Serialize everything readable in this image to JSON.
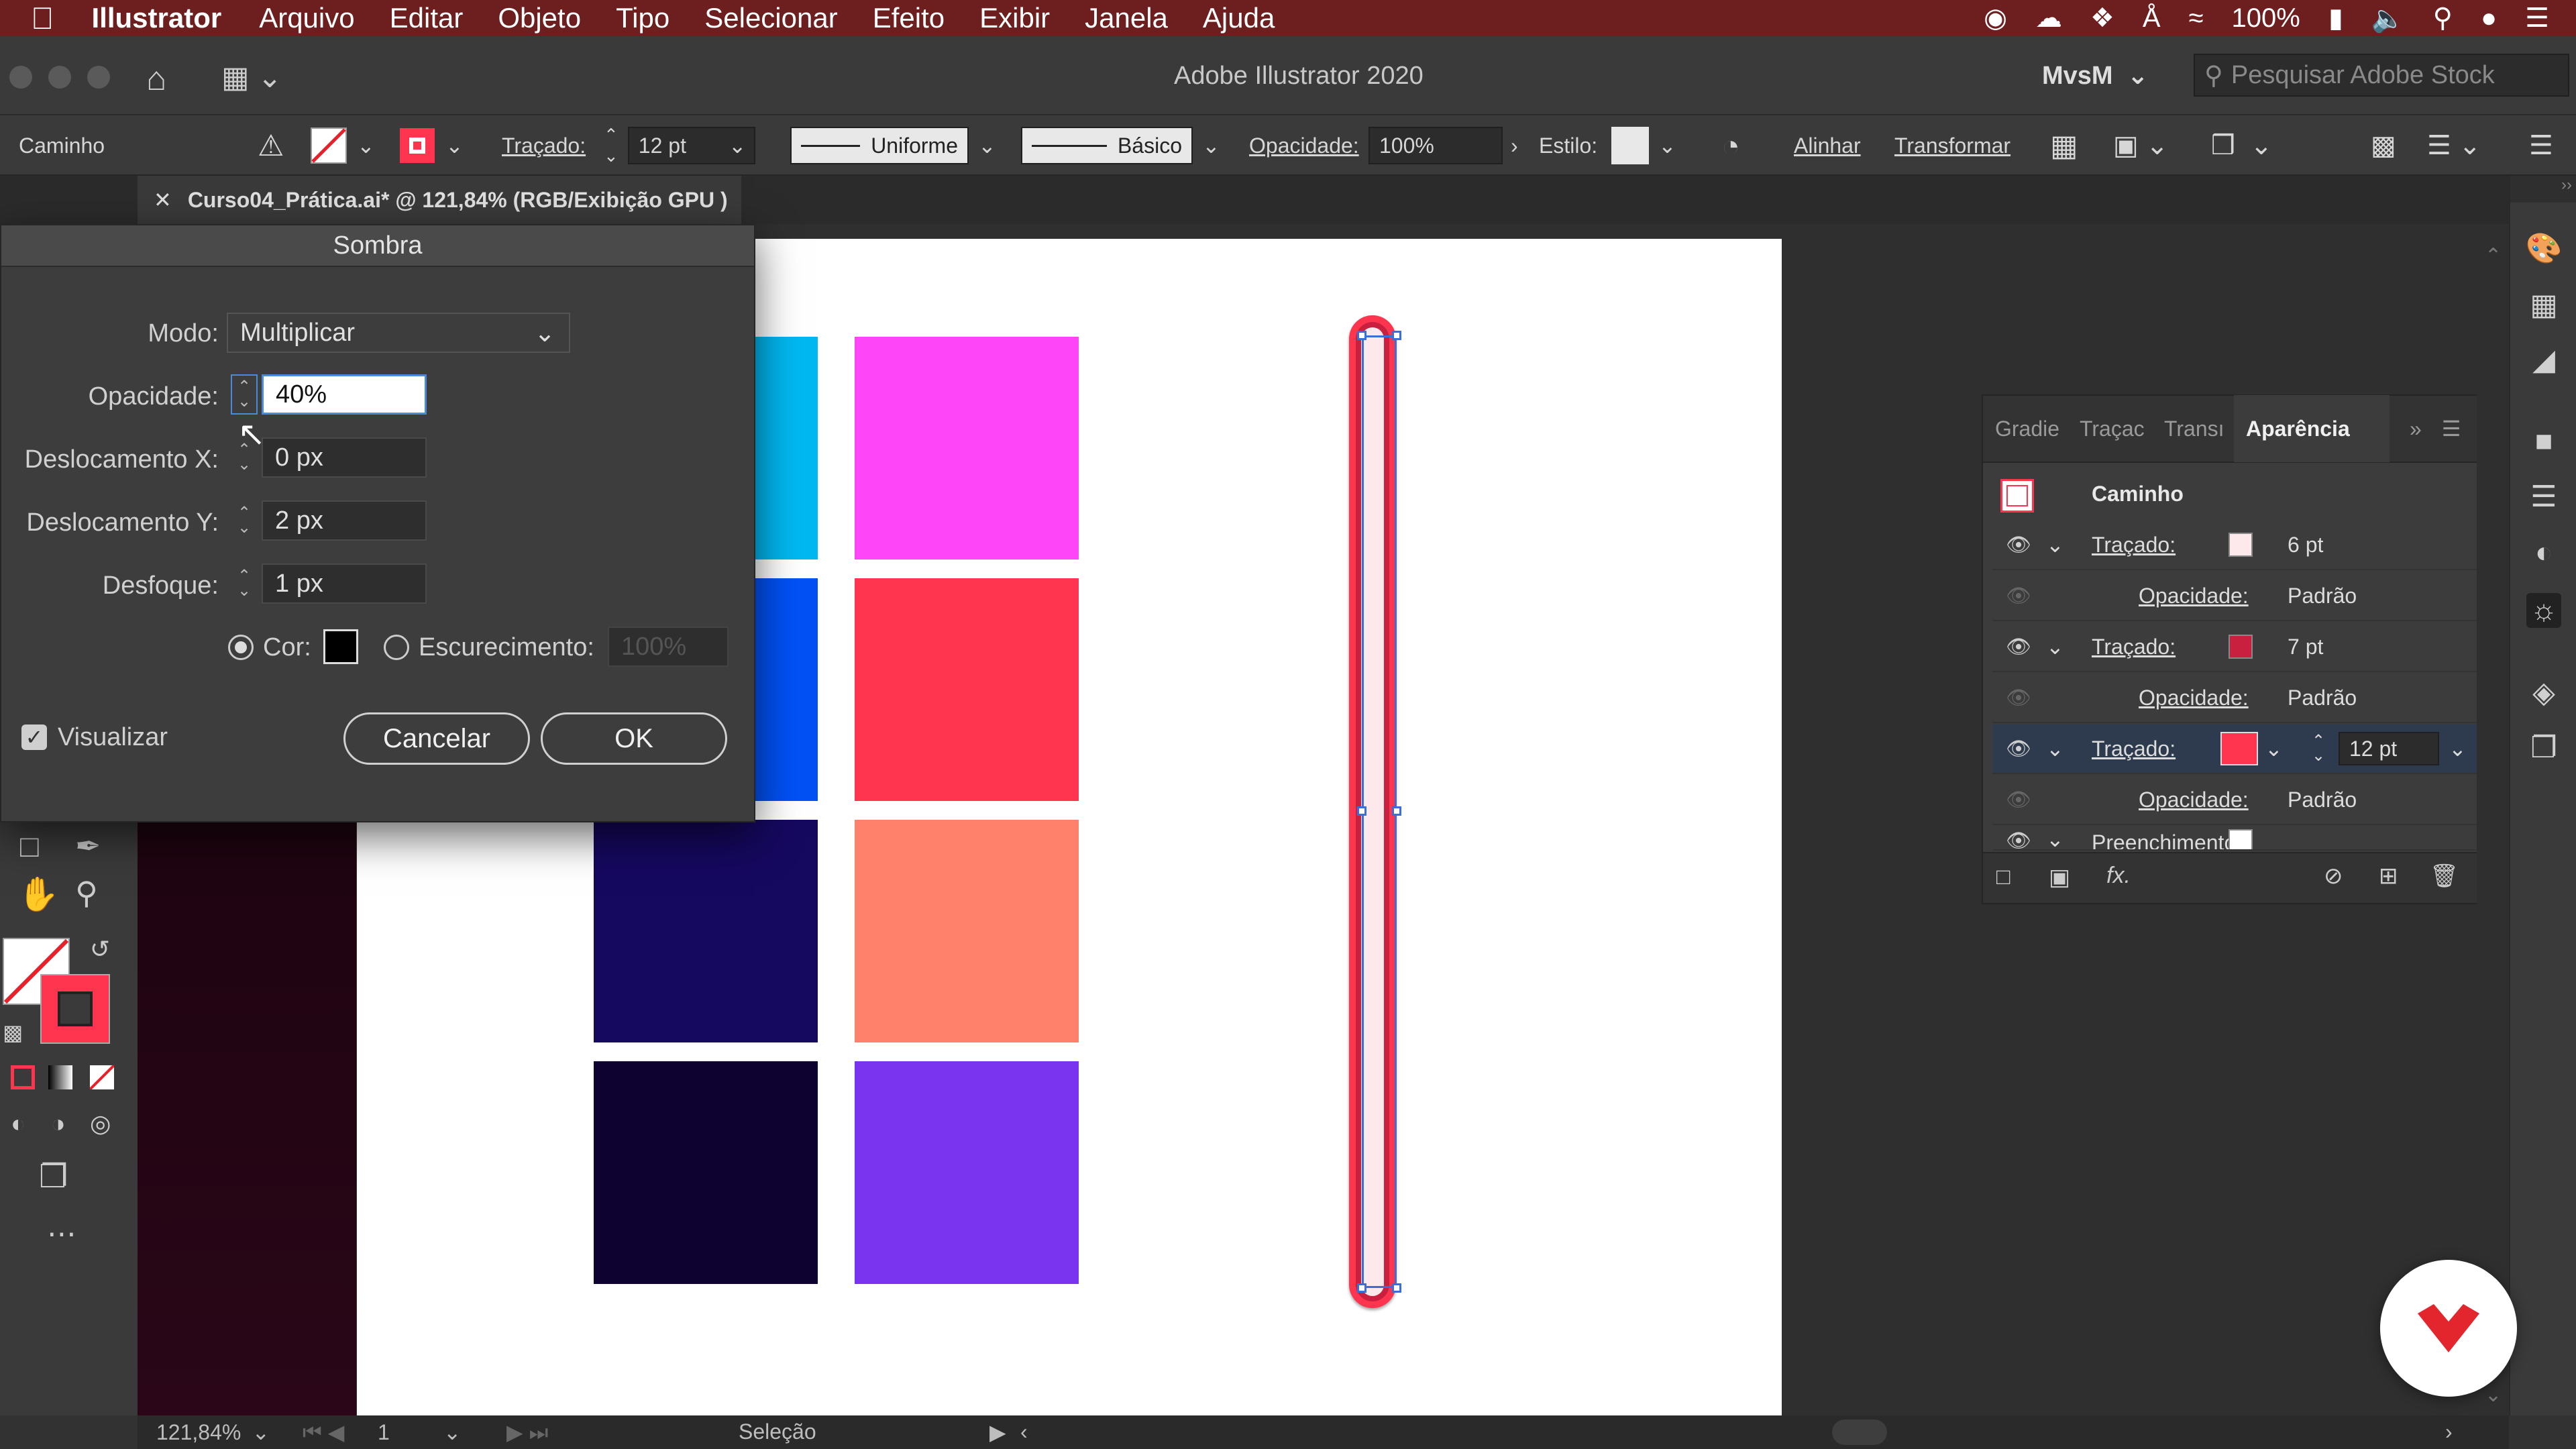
{
  "menubar": {
    "app_name": "Illustrator",
    "menus": [
      "Arquivo",
      "Editar",
      "Objeto",
      "Tipo",
      "Selecionar",
      "Efeito",
      "Exibir",
      "Janela",
      "Ajuda"
    ],
    "battery": "100%"
  },
  "titlebar": {
    "title": "Adobe Illustrator 2020",
    "workspace": "MvsM",
    "search_placeholder": "Pesquisar Adobe Stock"
  },
  "controlbar": {
    "object_type": "Caminho",
    "stroke_label": "Traçado:",
    "stroke_value": "12 pt",
    "profile": "Uniforme",
    "brush": "Básico",
    "opacity_label": "Opacidade:",
    "opacity_value": "100%",
    "style_label": "Estilo:",
    "align": "Alinhar",
    "transform": "Transformar"
  },
  "document": {
    "tab_title": "Curso04_Prática.ai* @ 121,84% (RGB/Exibição GPU )"
  },
  "swatches": {
    "colors": [
      "#00b8f0",
      "#ff45f7",
      "#0051f5",
      "#ff3550",
      "#15085f",
      "#ff816b",
      "#0e0230",
      "#7a34ef"
    ]
  },
  "dialog": {
    "title": "Sombra",
    "mode_label": "Modo:",
    "mode_value": "Multiplicar",
    "opacity_label": "Opacidade:",
    "opacity_value": "40%",
    "xoffset_label": "Deslocamento X:",
    "xoffset_value": "0 px",
    "yoffset_label": "Deslocamento Y:",
    "yoffset_value": "2 px",
    "blur_label": "Desfoque:",
    "blur_value": "1 px",
    "color_label": "Cor:",
    "darkness_label": "Escurecimento:",
    "darkness_value": "100%",
    "preview_label": "Visualizar",
    "cancel": "Cancelar",
    "ok": "OK"
  },
  "appearance": {
    "tabs": [
      "Gradie",
      "Traçac",
      "Transı",
      "Aparência"
    ],
    "object": "Caminho",
    "rows": [
      {
        "label": "Traçado:",
        "value": "6 pt",
        "swatch": "#fde8ec"
      },
      {
        "label": "Opacidade:",
        "value": "Padrão"
      },
      {
        "label": "Traçado:",
        "value": "7 pt",
        "swatch": "#c8203e"
      },
      {
        "label": "Opacidade:",
        "value": "Padrão"
      },
      {
        "label": "Traçado:",
        "value": "12 pt",
        "swatch": "#ff3550"
      },
      {
        "label": "Opacidade:",
        "value": "Padrão"
      },
      {
        "label": "Preenchimento:",
        "value": ""
      }
    ]
  },
  "status": {
    "zoom": "121,84%",
    "page": "1",
    "tool": "Seleção"
  },
  "colors": {
    "accent": "#ff3550",
    "menubar": "#6d1f1f"
  }
}
